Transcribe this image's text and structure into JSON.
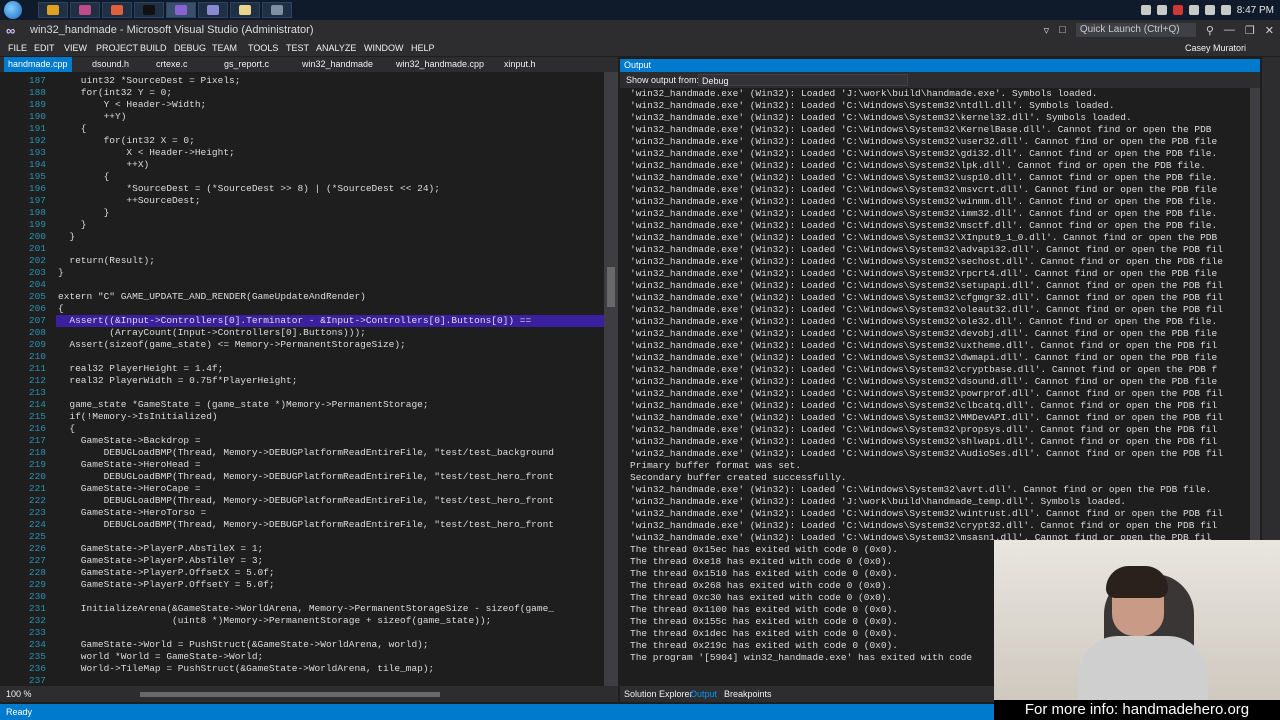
{
  "taskbar": {
    "clock": "8:47 PM"
  },
  "window": {
    "title": "win32_handmade - Microsoft Visual Studio (Administrator)",
    "quick_launch_placeholder": "Quick Launch (Ctrl+Q)",
    "user_name": "Casey Muratori"
  },
  "menu": [
    "FILE",
    "EDIT",
    "VIEW",
    "PROJECT",
    "BUILD",
    "DEBUG",
    "TEAM",
    "TOOLS",
    "TEST",
    "ANALYZE",
    "WINDOW",
    "HELP"
  ],
  "editor_tabs": [
    "handmade.cpp",
    "dsound.h",
    "crtexe.c",
    "gs_report.c",
    "win32_handmade",
    "win32_handmade.cpp",
    "xinput.h"
  ],
  "editor": {
    "zoom": "100 %",
    "highlight_line": "207",
    "lines": [
      {
        "n": "187",
        "code": "    uint32 *SourceDest = Pixels;"
      },
      {
        "n": "188",
        "code": "    for(int32 Y = 0;"
      },
      {
        "n": "189",
        "code": "        Y < Header->Width;"
      },
      {
        "n": "190",
        "code": "        ++Y)"
      },
      {
        "n": "191",
        "code": "    {"
      },
      {
        "n": "192",
        "code": "        for(int32 X = 0;"
      },
      {
        "n": "193",
        "code": "            X < Header->Height;"
      },
      {
        "n": "194",
        "code": "            ++X)"
      },
      {
        "n": "195",
        "code": "        {"
      },
      {
        "n": "196",
        "code": "            *SourceDest = (*SourceDest >> 8) | (*SourceDest << 24);"
      },
      {
        "n": "197",
        "code": "            ++SourceDest;"
      },
      {
        "n": "198",
        "code": "        }"
      },
      {
        "n": "199",
        "code": "    }"
      },
      {
        "n": "200",
        "code": "  }"
      },
      {
        "n": "201",
        "code": ""
      },
      {
        "n": "202",
        "code": "  return(Result);"
      },
      {
        "n": "203",
        "code": "}"
      },
      {
        "n": "204",
        "code": ""
      },
      {
        "n": "205",
        "code": "extern \"C\" GAME_UPDATE_AND_RENDER(GameUpdateAndRender)"
      },
      {
        "n": "206",
        "code": "{"
      },
      {
        "n": "207",
        "code": "  Assert((&Input->Controllers[0].Terminator - &Input->Controllers[0].Buttons[0]) =="
      },
      {
        "n": "208",
        "code": "         (ArrayCount(Input->Controllers[0].Buttons)));"
      },
      {
        "n": "209",
        "code": "  Assert(sizeof(game_state) <= Memory->PermanentStorageSize);"
      },
      {
        "n": "210",
        "code": ""
      },
      {
        "n": "211",
        "code": "  real32 PlayerHeight = 1.4f;"
      },
      {
        "n": "212",
        "code": "  real32 PlayerWidth = 0.75f*PlayerHeight;"
      },
      {
        "n": "213",
        "code": ""
      },
      {
        "n": "214",
        "code": "  game_state *GameState = (game_state *)Memory->PermanentStorage;"
      },
      {
        "n": "215",
        "code": "  if(!Memory->IsInitialized)"
      },
      {
        "n": "216",
        "code": "  {"
      },
      {
        "n": "217",
        "code": "    GameState->Backdrop ="
      },
      {
        "n": "218",
        "code": "        DEBUGLoadBMP(Thread, Memory->DEBUGPlatformReadEntireFile, \"test/test_background"
      },
      {
        "n": "219",
        "code": "    GameState->HeroHead ="
      },
      {
        "n": "220",
        "code": "        DEBUGLoadBMP(Thread, Memory->DEBUGPlatformReadEntireFile, \"test/test_hero_front"
      },
      {
        "n": "221",
        "code": "    GameState->HeroCape ="
      },
      {
        "n": "222",
        "code": "        DEBUGLoadBMP(Thread, Memory->DEBUGPlatformReadEntireFile, \"test/test_hero_front"
      },
      {
        "n": "223",
        "code": "    GameState->HeroTorso ="
      },
      {
        "n": "224",
        "code": "        DEBUGLoadBMP(Thread, Memory->DEBUGPlatformReadEntireFile, \"test/test_hero_front"
      },
      {
        "n": "225",
        "code": ""
      },
      {
        "n": "226",
        "code": "    GameState->PlayerP.AbsTileX = 1;"
      },
      {
        "n": "227",
        "code": "    GameState->PlayerP.AbsTileY = 3;"
      },
      {
        "n": "228",
        "code": "    GameState->PlayerP.OffsetX = 5.0f;"
      },
      {
        "n": "229",
        "code": "    GameState->PlayerP.OffsetY = 5.0f;"
      },
      {
        "n": "230",
        "code": ""
      },
      {
        "n": "231",
        "code": "    InitializeArena(&GameState->WorldArena, Memory->PermanentStorageSize - sizeof(game_"
      },
      {
        "n": "232",
        "code": "                    (uint8 *)Memory->PermanentStorage + sizeof(game_state));"
      },
      {
        "n": "233",
        "code": ""
      },
      {
        "n": "234",
        "code": "    GameState->World = PushStruct(&GameState->WorldArena, world);"
      },
      {
        "n": "235",
        "code": "    world *World = GameState->World;"
      },
      {
        "n": "236",
        "code": "    World->TileMap = PushStruct(&GameState->WorldArena, tile_map);"
      },
      {
        "n": "237",
        "code": ""
      }
    ]
  },
  "output": {
    "title": "Output",
    "show_label": "Show output from:",
    "source": "Debug",
    "lines": [
      "'win32_handmade.exe' (Win32): Loaded 'J:\\work\\build\\handmade.exe'. Symbols loaded.",
      "'win32_handmade.exe' (Win32): Loaded 'C:\\Windows\\System32\\ntdll.dll'. Symbols loaded.",
      "'win32_handmade.exe' (Win32): Loaded 'C:\\Windows\\System32\\kernel32.dll'. Symbols loaded.",
      "'win32_handmade.exe' (Win32): Loaded 'C:\\Windows\\System32\\KernelBase.dll'. Cannot find or open the PDB",
      "'win32_handmade.exe' (Win32): Loaded 'C:\\Windows\\System32\\user32.dll'. Cannot find or open the PDB file",
      "'win32_handmade.exe' (Win32): Loaded 'C:\\Windows\\System32\\gdi32.dll'. Cannot find or open the PDB file.",
      "'win32_handmade.exe' (Win32): Loaded 'C:\\Windows\\System32\\lpk.dll'. Cannot find or open the PDB file.",
      "'win32_handmade.exe' (Win32): Loaded 'C:\\Windows\\System32\\usp10.dll'. Cannot find or open the PDB file.",
      "'win32_handmade.exe' (Win32): Loaded 'C:\\Windows\\System32\\msvcrt.dll'. Cannot find or open the PDB file",
      "'win32_handmade.exe' (Win32): Loaded 'C:\\Windows\\System32\\winmm.dll'. Cannot find or open the PDB file.",
      "'win32_handmade.exe' (Win32): Loaded 'C:\\Windows\\System32\\imm32.dll'. Cannot find or open the PDB file.",
      "'win32_handmade.exe' (Win32): Loaded 'C:\\Windows\\System32\\msctf.dll'. Cannot find or open the PDB file.",
      "'win32_handmade.exe' (Win32): Loaded 'C:\\Windows\\System32\\XInput9_1_0.dll'. Cannot find or open the PDB",
      "'win32_handmade.exe' (Win32): Loaded 'C:\\Windows\\System32\\advapi32.dll'. Cannot find or open the PDB fil",
      "'win32_handmade.exe' (Win32): Loaded 'C:\\Windows\\System32\\sechost.dll'. Cannot find or open the PDB file",
      "'win32_handmade.exe' (Win32): Loaded 'C:\\Windows\\System32\\rpcrt4.dll'. Cannot find or open the PDB file",
      "'win32_handmade.exe' (Win32): Loaded 'C:\\Windows\\System32\\setupapi.dll'. Cannot find or open the PDB fil",
      "'win32_handmade.exe' (Win32): Loaded 'C:\\Windows\\System32\\cfgmgr32.dll'. Cannot find or open the PDB fil",
      "'win32_handmade.exe' (Win32): Loaded 'C:\\Windows\\System32\\oleaut32.dll'. Cannot find or open the PDB fil",
      "'win32_handmade.exe' (Win32): Loaded 'C:\\Windows\\System32\\ole32.dll'. Cannot find or open the PDB file.",
      "'win32_handmade.exe' (Win32): Loaded 'C:\\Windows\\System32\\devobj.dll'. Cannot find or open the PDB file",
      "'win32_handmade.exe' (Win32): Loaded 'C:\\Windows\\System32\\uxtheme.dll'. Cannot find or open the PDB fil",
      "'win32_handmade.exe' (Win32): Loaded 'C:\\Windows\\System32\\dwmapi.dll'. Cannot find or open the PDB file",
      "'win32_handmade.exe' (Win32): Loaded 'C:\\Windows\\System32\\cryptbase.dll'. Cannot find or open the PDB f",
      "'win32_handmade.exe' (Win32): Loaded 'C:\\Windows\\System32\\dsound.dll'. Cannot find or open the PDB file",
      "'win32_handmade.exe' (Win32): Loaded 'C:\\Windows\\System32\\powrprof.dll'. Cannot find or open the PDB fil",
      "'win32_handmade.exe' (Win32): Loaded 'C:\\Windows\\System32\\clbcatq.dll'. Cannot find or open the PDB fil",
      "'win32_handmade.exe' (Win32): Loaded 'C:\\Windows\\System32\\MMDevAPI.dll'. Cannot find or open the PDB fil",
      "'win32_handmade.exe' (Win32): Loaded 'C:\\Windows\\System32\\propsys.dll'. Cannot find or open the PDB fil",
      "'win32_handmade.exe' (Win32): Loaded 'C:\\Windows\\System32\\shlwapi.dll'. Cannot find or open the PDB fil",
      "'win32_handmade.exe' (Win32): Loaded 'C:\\Windows\\System32\\AudioSes.dll'. Cannot find or open the PDB fil",
      "Primary buffer format was set.",
      "Secondary buffer created successfully.",
      "'win32_handmade.exe' (Win32): Loaded 'C:\\Windows\\System32\\avrt.dll'. Cannot find or open the PDB file.",
      "'win32_handmade.exe' (Win32): Loaded 'J:\\work\\build\\handmade_temp.dll'. Symbols loaded.",
      "'win32_handmade.exe' (Win32): Loaded 'C:\\Windows\\System32\\wintrust.dll'. Cannot find or open the PDB fil",
      "'win32_handmade.exe' (Win32): Loaded 'C:\\Windows\\System32\\crypt32.dll'. Cannot find or open the PDB fil",
      "'win32_handmade.exe' (Win32): Loaded 'C:\\Windows\\System32\\msasn1.dll'. Cannot find or open the PDB fil",
      "The thread 0x15ec has exited with code 0 (0x0).",
      "The thread 0xe18 has exited with code 0 (0x0).",
      "The thread 0x1510 has exited with code 0 (0x0).",
      "The thread 0x268 has exited with code 0 (0x0).",
      "The thread 0xc30 has exited with code 0 (0x0).",
      "The thread 0x1100 has exited with code 0 (0x0).",
      "The thread 0x155c has exited with code 0 (0x0).",
      "The thread 0x1dec has exited with code 0 (0x0).",
      "The thread 0x219c has exited with code 0 (0x0).",
      "The program '[5904] win32_handmade.exe' has exited with code"
    ]
  },
  "bottom_tabs": [
    "Solution Explorer",
    "Output",
    "Breakpoints"
  ],
  "status": "Ready",
  "caption": "For more info: handmadehero.org",
  "colors": {
    "accent": "#007acc",
    "selection": "#3a1f9e",
    "line_number": "#2b91af"
  }
}
